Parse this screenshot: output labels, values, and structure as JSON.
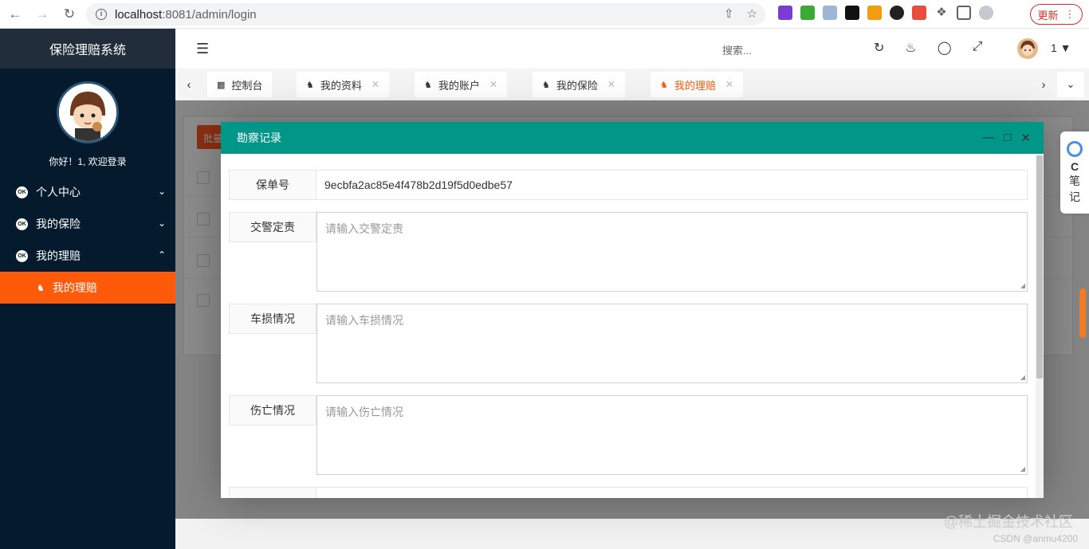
{
  "browser": {
    "url_host": "localhost",
    "url_path": ":8081/admin/login",
    "update_label": "更新"
  },
  "sidebar": {
    "title": "保险理赔系统",
    "welcome": "你好！1, 欢迎登录",
    "items": [
      {
        "label": "个人中心"
      },
      {
        "label": "我的保险"
      },
      {
        "label": "我的理赔"
      }
    ],
    "sub_item": "我的理赔",
    "icon_badge": "OK"
  },
  "header": {
    "search_placeholder": "搜索...",
    "username": "1"
  },
  "tabs": [
    {
      "label": "控制台"
    },
    {
      "label": "我的资料"
    },
    {
      "label": "我的账户"
    },
    {
      "label": "我的保险"
    },
    {
      "label": "我的理赔"
    }
  ],
  "modal": {
    "title": "勘察记录",
    "fields": [
      {
        "label": "保单号",
        "value": "9ecbfa2ac85e4f478b2d19f5d0edbe57"
      },
      {
        "label": "交警定责",
        "placeholder": "请输入交警定责"
      },
      {
        "label": "车损情况",
        "placeholder": "请输入车损情况"
      },
      {
        "label": "伤亡情况",
        "placeholder": "请输入伤亡情况"
      }
    ]
  },
  "background": {
    "batch_label": "批量"
  },
  "side_widget": {
    "line1": "C",
    "line2": "笔",
    "line3": "记"
  },
  "watermark": {
    "main": "@稀土掘金技术社区",
    "sub": "CSDN @anmu4200"
  },
  "colors": {
    "sidebar_bg": "#051a2d",
    "accent": "#ff5a0a",
    "modal_header": "#009688"
  }
}
